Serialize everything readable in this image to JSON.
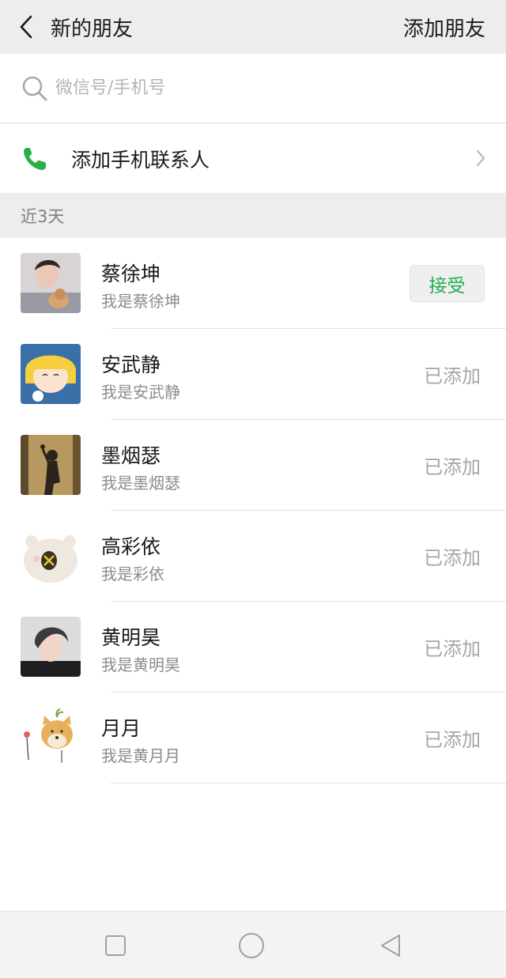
{
  "header": {
    "title": "新的朋友",
    "action_label": "添加朋友"
  },
  "search": {
    "placeholder": "微信号/手机号"
  },
  "phone_contacts": {
    "label": "添加手机联系人"
  },
  "section": {
    "label": "近3天"
  },
  "contacts": [
    {
      "name": "蔡徐坤",
      "message": "我是蔡徐坤",
      "action": "接受"
    },
    {
      "name": "安武静",
      "message": "我是安武静",
      "action": "已添加"
    },
    {
      "name": "墨烟瑟",
      "message": "我是墨烟瑟",
      "action": "已添加"
    },
    {
      "name": "高彩依",
      "message": "我是彩依",
      "action": "已添加"
    },
    {
      "name": "黄明昊",
      "message": "我是黄明昊",
      "action": "已添加"
    },
    {
      "name": "月月",
      "message": "我是黄月月",
      "action": "已添加"
    }
  ],
  "icons": {
    "back": "back-arrow-icon",
    "search": "search-icon",
    "phone": "phone-icon",
    "chevron": "chevron-right-icon",
    "nav_recent": "square-icon",
    "nav_home": "circle-icon",
    "nav_back": "triangle-back-icon"
  },
  "colors": {
    "accent_green": "#20b04f",
    "header_bg": "#ededed"
  }
}
